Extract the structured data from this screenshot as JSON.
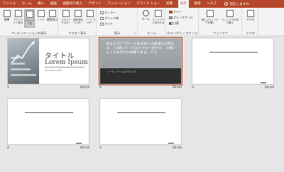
{
  "tabs": [
    "ファイル",
    "ホーム",
    "挿入",
    "描画",
    "画面切り替え",
    "デザイン",
    "アニメーション",
    "スライド ショー",
    "校閲",
    "表示",
    "録音",
    "ヘルプ"
  ],
  "active_tab": "表示",
  "tell_me": "何をしますか",
  "ribbon": {
    "presentation_views": {
      "label": "プレゼンテーションの表示",
      "buttons": [
        "標準",
        "アウトライン表示",
        "スライド一覧",
        "ノート",
        "閲覧表示"
      ]
    },
    "master_views": {
      "label": "マスター表示",
      "buttons": [
        "スライド マスター",
        "配布資料マスター",
        "ノート マスター"
      ]
    },
    "show": {
      "label": "表示",
      "checks": [
        "ルーラー",
        "グリッド線",
        "ガイド"
      ]
    },
    "zoom": {
      "label": "ズーム",
      "buttons": [
        "ズーム",
        "ウィンドウに合わせる"
      ]
    },
    "color": {
      "label": "カラー/グレースケール",
      "options": [
        "カラー",
        "グレースケール",
        "白黒"
      ]
    },
    "window": {
      "label": "ウィンドウ",
      "buttons": [
        "新しいウィンドウを開く",
        "ウィンドウの切り替え"
      ]
    },
    "macro": {
      "label": "マクロ",
      "buttons": [
        "マクロ"
      ]
    }
  },
  "slides": [
    {
      "num": "1",
      "time": "00:03",
      "title": "タイトル",
      "subtitle": "Lorem Ipsum",
      "note": "DIT DOLOR AMET"
    },
    {
      "num": "2",
      "time": "00:04",
      "body": "あなたのアプローチを反映する最適な引用文は、「人間にとっては小さな一歩だが、人類にとっては大きな飛躍である」です。",
      "caption": "ニール・アームストロング"
    },
    {
      "num": "3",
      "time": "00:04"
    },
    {
      "num": "4",
      "time": "00:04"
    },
    {
      "num": "5",
      "time": "00:04"
    }
  ],
  "colors": {
    "accent": "#b7472a",
    "selection": "#c43e1c"
  }
}
